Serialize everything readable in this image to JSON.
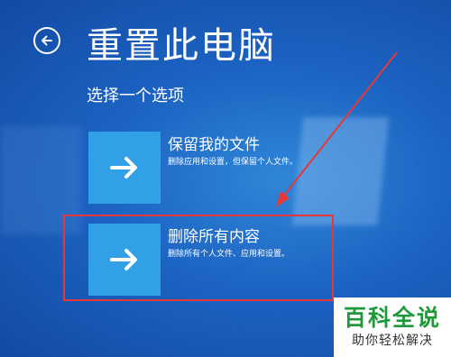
{
  "window": {
    "background_color": "#1c63c2",
    "tile_color": "#32a0e6",
    "highlight_color": "#e23a3a"
  },
  "header": {
    "back_icon": "back-arrow-circle-icon",
    "title": "重置此电脑"
  },
  "prompt": "选择一个选项",
  "options": [
    {
      "title": "保留我的文件",
      "description": "删除应用和设置，但保留个人文件。",
      "icon": "arrow-right-icon"
    },
    {
      "title": "删除所有内容",
      "description": "删除所有个人文件、应用和设置。",
      "icon": "arrow-right-icon",
      "highlighted": true
    }
  ],
  "watermark": {
    "title": "百科全说",
    "subtitle": "助你轻松解决",
    "color": "#1f9a3a"
  }
}
